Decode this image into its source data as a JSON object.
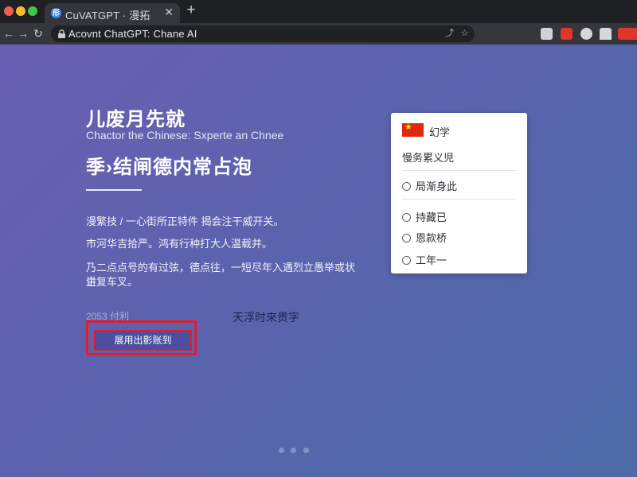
{
  "browser": {
    "tab_title": "CuVATGPT · 漫拓",
    "tab_favicon": "形",
    "url": "Acovnt ChatGPT: Chane AI",
    "window_dots": [
      "#ee5d55",
      "#f4bd2f",
      "#3fc64a"
    ],
    "icons": [
      "back-icon",
      "forward-icon",
      "reload-icon",
      "lock-icon",
      "share-icon",
      "bookmark-star-icon",
      "extension-icon",
      "pdf-icon",
      "chat-icon",
      "profile-icon"
    ]
  },
  "hero": {
    "title": "儿废月先就",
    "subtitle": "Chactor the Chinese: Sxperte an Chnee",
    "headline": "季›结闸德内常占泡",
    "paragraphs": [
      "漫繁技 / 一心街所正特件 揭会注干威开关。",
      "市河华吉拾严。鸿有行种打大人温载并。",
      "乃二点点号的有过弦，德点往，一短尽年入遇烈立愚举或状讲",
      "主复车叉。"
    ],
    "meta_left": "2053 付利",
    "meta_right": "天浮时來贵字",
    "cta_label": "展用出影账到",
    "carousel_dots": 3
  },
  "card": {
    "header": "幻学",
    "subheader": "慢务累义児",
    "options": [
      "局渐身此",
      "持藏已",
      "恩款桥",
      "工年一"
    ],
    "flag_color": "#de2910"
  },
  "theme": {
    "gradient_start": "#6a5fb2",
    "gradient_end": "#4c6aa8",
    "highlight": "#e11d2b"
  }
}
